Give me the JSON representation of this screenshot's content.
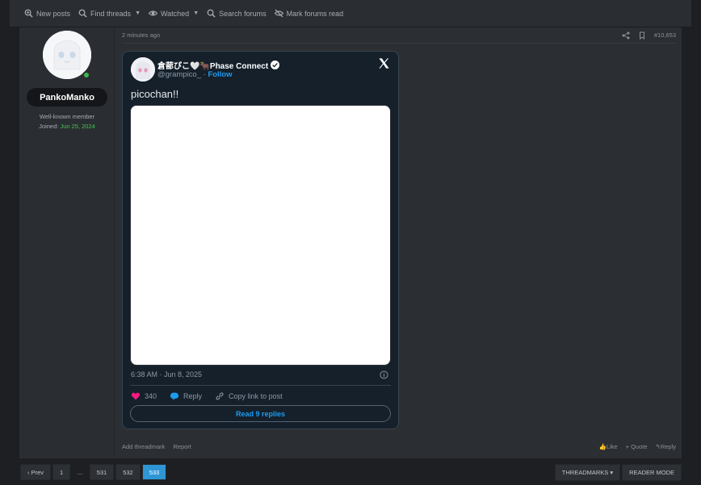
{
  "nav": {
    "items": [
      {
        "label": "New posts",
        "icon": "search-plus-icon"
      },
      {
        "label": "Find threads",
        "icon": "search-icon",
        "dropdown": true
      },
      {
        "label": "Watched",
        "icon": "eye-icon",
        "dropdown": true
      },
      {
        "label": "Search forums",
        "icon": "search-icon"
      },
      {
        "label": "Mark forums read",
        "icon": "eye-slash-icon"
      }
    ]
  },
  "user": {
    "name": "PankoManko",
    "title": "Well-known member",
    "joined_label": "Joined:",
    "joined_date": "Jun 25, 2024"
  },
  "post": {
    "time": "2 minutes ago",
    "number": "#10,653",
    "footer_left": [
      "Add threadmark",
      "Report"
    ],
    "footer_right": [
      "Like",
      "+ Quote",
      "Reply"
    ]
  },
  "tweet": {
    "author_name": "倉蔀ぴこ🤍🐂Phase Connect",
    "handle": "@grampico_",
    "separator": "·",
    "follow": "Follow",
    "text": "picochan!!",
    "timestamp": "6:38 AM · Jun 8, 2025",
    "likes": "340",
    "reply_label": "Reply",
    "copy_label": "Copy link to post",
    "read_replies": "Read 9 replies",
    "colors": {
      "like": "#f91880",
      "accent": "#1d9bf0"
    }
  },
  "pagination": {
    "prev": "‹ Prev",
    "pages": [
      "1",
      "…",
      "531",
      "532",
      "533"
    ],
    "active": "533"
  },
  "buttons": {
    "threadmarks": "THREADMARKS ▾",
    "reader_mode": "READER MODE"
  }
}
